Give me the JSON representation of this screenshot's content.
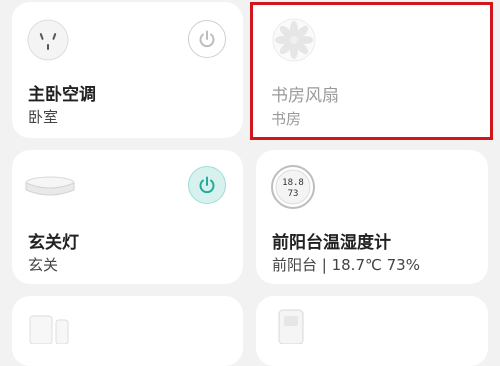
{
  "devices": [
    {
      "name": "主卧空调",
      "room": "卧室",
      "icon": "power-socket-icon",
      "power": "off"
    },
    {
      "name": "书房风扇",
      "room": "书房",
      "icon": "fan-icon",
      "status": "offline"
    },
    {
      "name": "玄关灯",
      "room": "玄关",
      "icon": "ceiling-light-icon",
      "power": "on"
    },
    {
      "name": "前阳台温湿度计",
      "room": "前阳台 | 18.7℃ 73%",
      "icon": "thermo-hygrometer-icon"
    },
    {
      "name": "",
      "room": "",
      "icon": "door-window-sensor-icon"
    },
    {
      "name": "",
      "room": "",
      "icon": "motion-sensor-icon"
    }
  ],
  "colors": {
    "power_on_bg": "#d7f1ef",
    "power_on_icon": "#27a89a",
    "selection_border": "#d0161b"
  },
  "thermometer_display": {
    "reading_top": "18.8",
    "reading_bottom": "73"
  }
}
